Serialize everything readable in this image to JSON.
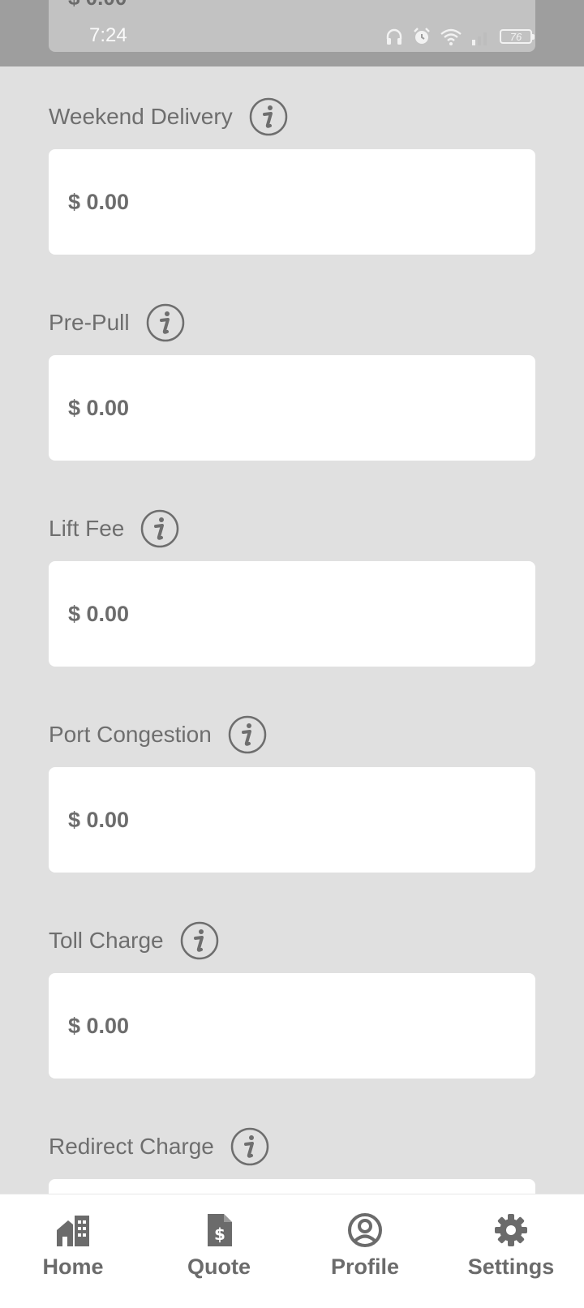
{
  "status_bar": {
    "time": "7:24",
    "battery": "76",
    "icons": [
      "headphones-icon",
      "alarm-icon",
      "wifi-icon",
      "signal-icon",
      "battery-icon"
    ]
  },
  "ghost_value": "$ 0.00",
  "fields": [
    {
      "label": "Weekend Delivery",
      "value": "$ 0.00"
    },
    {
      "label": "Pre-Pull",
      "value": "$ 0.00"
    },
    {
      "label": "Lift Fee",
      "value": "$ 0.00"
    },
    {
      "label": "Port Congestion",
      "value": "$ 0.00"
    },
    {
      "label": "Toll Charge",
      "value": "$ 0.00"
    },
    {
      "label": "Redirect Charge",
      "value": ""
    }
  ],
  "nav": {
    "items": [
      {
        "label": "Home",
        "icon": "home-icon"
      },
      {
        "label": "Quote",
        "icon": "quote-document-icon"
      },
      {
        "label": "Profile",
        "icon": "profile-icon"
      },
      {
        "label": "Settings",
        "icon": "gear-icon"
      }
    ]
  },
  "colors": {
    "background": "#e0e0e0",
    "statusbar": "#9e9e9e",
    "card": "#ffffff",
    "text": "#6a6a6a"
  }
}
